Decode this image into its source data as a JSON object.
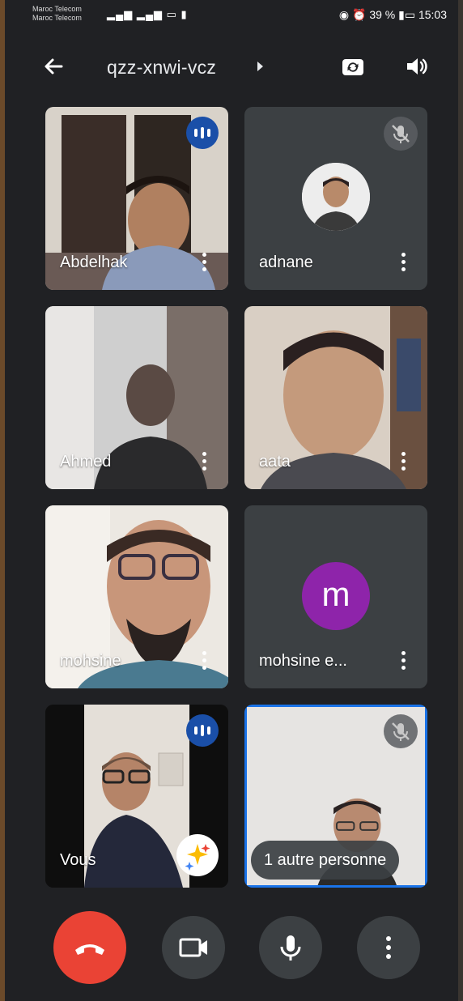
{
  "status_bar": {
    "carrier_1": "Maroc Telecom",
    "carrier_2": "Maroc Telecom",
    "battery_text": "39 %",
    "time": "15:03"
  },
  "top_bar": {
    "meeting_code": "qzz-xnwi-vcz",
    "back_icon": "arrow-left-icon",
    "switch_camera_icon": "camera-switch-icon",
    "audio_icon": "speaker-icon"
  },
  "participants": [
    {
      "name": "Abdelhak",
      "state": "speaking"
    },
    {
      "name": "adnane",
      "state": "muted"
    },
    {
      "name": "Ahmed",
      "state": "video"
    },
    {
      "name": "aata",
      "state": "video"
    },
    {
      "name": "mohsine",
      "state": "video"
    },
    {
      "name": "mohsine e...",
      "avatar_letter": "m",
      "state": "camera-off"
    },
    {
      "name": "Vous",
      "state": "speaking"
    },
    {
      "name": "1 autre personne",
      "state": "muted"
    }
  ],
  "controls": [
    {
      "label": "end-call",
      "color": "#ea4335"
    },
    {
      "label": "camera"
    },
    {
      "label": "microphone"
    },
    {
      "label": "more-options"
    }
  ],
  "colors": {
    "background": "#202124",
    "tile": "#3c4043",
    "accent": "#1a73e8",
    "end_call": "#ea4335",
    "avatar_m": "#8e24aa"
  }
}
